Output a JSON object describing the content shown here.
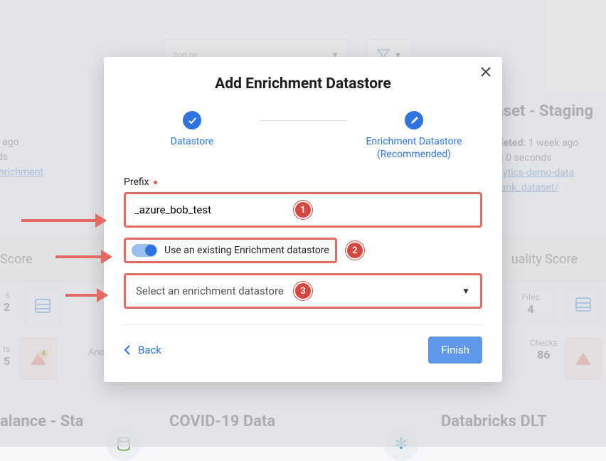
{
  "background": {
    "sort_label": "Sort by",
    "right_card": {
      "title": "aset - Staging",
      "completed_label": "pleted:",
      "completed_value": "1 week ago",
      "duration_label": "n:",
      "duration_value": "0 seconds",
      "link1": "alytics-demo-data",
      "link2": "bank_dataset/"
    },
    "left_card": {
      "line1": "urs ago",
      "line2": "onds",
      "link": "v-enrichment"
    },
    "quality_left": "Score",
    "quality_right": "uality Score",
    "stat_left_label": "s",
    "stat_left_value": "2",
    "files_label": "Files",
    "files_value": "4",
    "anom_left_label": "ts",
    "anom_left_value": "5",
    "anom_badge": "4",
    "anom_word": "Ano",
    "checks_label": "Checks",
    "checks_value": "86",
    "bottom1": "alance - Sta",
    "bottom2": "COVID-19 Data",
    "bottom3": "Databricks DLT"
  },
  "modal": {
    "title": "Add Enrichment Datastore",
    "step1": "Datastore",
    "step2": "Enrichment Datastore",
    "step2_sub": "(Recommended)",
    "prefix_label": "Prefix",
    "prefix_value": "_azure_bob_test",
    "toggle_label": "Use an existing Enrichment datastore",
    "select_placeholder": "Select an enrichment datastore",
    "back": "Back",
    "finish": "Finish",
    "badge1": "1",
    "badge2": "2",
    "badge3": "3"
  }
}
